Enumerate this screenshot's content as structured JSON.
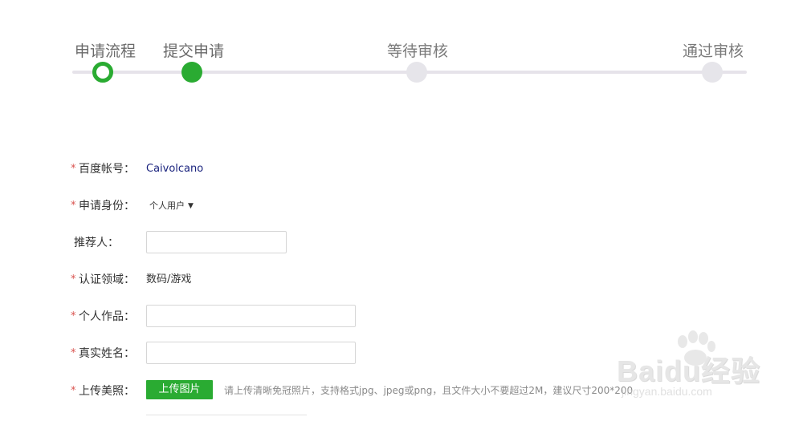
{
  "progress": {
    "steps": [
      {
        "label": "申请流程",
        "state": "current"
      },
      {
        "label": "提交申请",
        "state": "done"
      },
      {
        "label": "等待审核",
        "state": "pending"
      },
      {
        "label": "通过审核",
        "state": "pending"
      }
    ],
    "accent_color": "#2aab32",
    "pending_color": "#e6e5ea"
  },
  "form": {
    "required_mark": "*",
    "account": {
      "label": "百度帐号：",
      "value": "Caivolcano"
    },
    "identity": {
      "label": "申请身份：",
      "value": "个人用户",
      "caret": "▼"
    },
    "referrer": {
      "label": "推荐人：",
      "value": ""
    },
    "domain": {
      "label": "认证领域：",
      "value": "数码/游戏"
    },
    "works": {
      "label": "个人作品：",
      "value": ""
    },
    "real_name": {
      "label": "真实姓名：",
      "value": ""
    },
    "photo": {
      "label": "上传美照：",
      "button_label": "上传图片",
      "hint": "请上传清晰免冠照片，支持格式jpg、jpeg或png，且文件大小不要超过2M，建议尺寸200*200"
    }
  },
  "watermark": {
    "brand": "Baidu经验",
    "url": "jingyan.baidu.com"
  }
}
